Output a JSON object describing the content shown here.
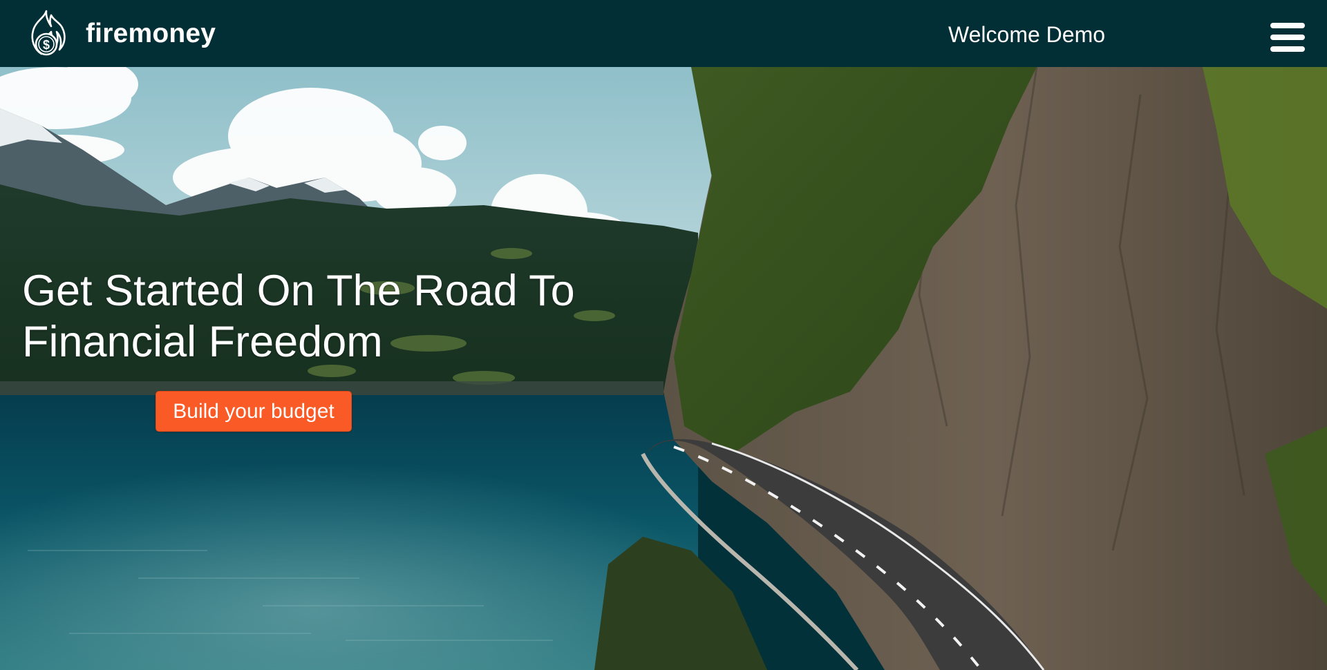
{
  "nav": {
    "brand_name": "firemoney",
    "logo_icon": "fire-dollar-coin-icon",
    "welcome_text": "Welcome Demo",
    "menu_icon": "hamburger-menu-icon",
    "background_color": "#022e36"
  },
  "hero": {
    "title_line1": "Get Started On The Road To",
    "title_line2": "Financial Freedom",
    "cta_label": "Build your budget",
    "cta_color": "#fa5a25",
    "background_image": "lake-mountain-coastal-road-photo"
  }
}
